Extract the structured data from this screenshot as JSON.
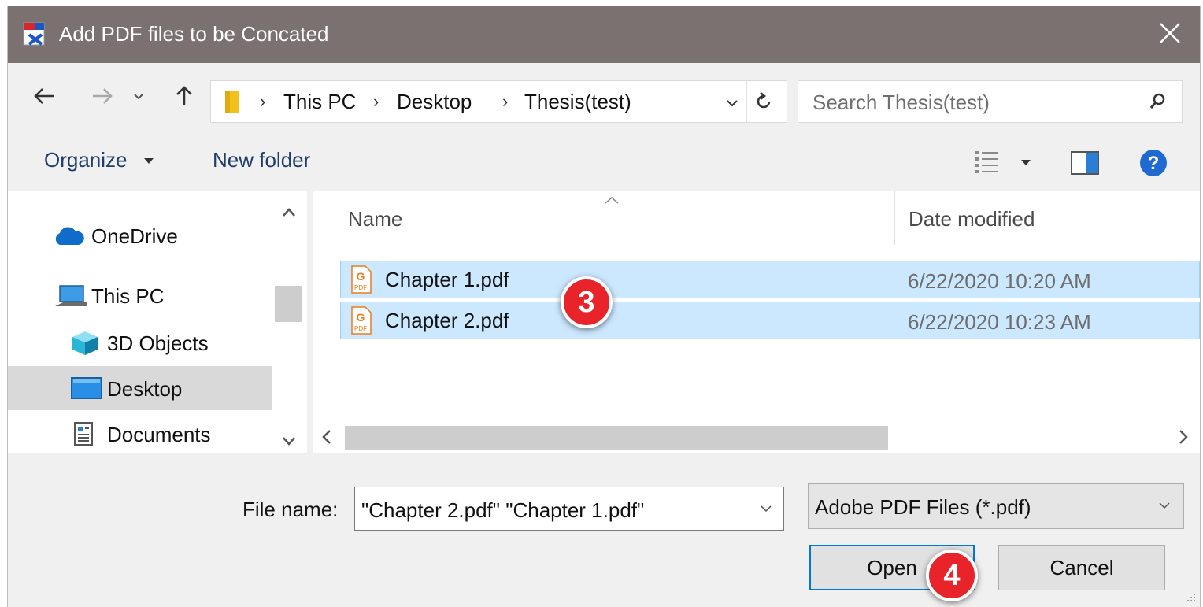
{
  "window": {
    "title": "Add PDF files to be Concated",
    "close_icon": "close-icon"
  },
  "nav": {
    "back_icon": "back-arrow-icon",
    "forward_icon": "forward-arrow-icon",
    "recent_icon": "chevron-down-icon",
    "up_icon": "up-arrow-icon",
    "breadcrumbs": [
      "This PC",
      "Desktop",
      "Thesis(test)"
    ],
    "refresh_icon": "refresh-icon",
    "search_placeholder": "Search Thesis(test)"
  },
  "toolbar": {
    "organize": "Organize",
    "new_folder": "New folder"
  },
  "sidebar": {
    "items": [
      {
        "label": "OneDrive",
        "icon": "cloud-icon"
      },
      {
        "label": "This PC",
        "icon": "computer-icon"
      },
      {
        "label": "3D Objects",
        "icon": "cube-icon"
      },
      {
        "label": "Desktop",
        "icon": "desktop-icon",
        "selected": true
      },
      {
        "label": "Documents",
        "icon": "document-icon"
      }
    ]
  },
  "files": {
    "columns": [
      "Name",
      "Date modified"
    ],
    "rows": [
      {
        "name": "Chapter 1.pdf",
        "date": "6/22/2020 10:20 AM",
        "selected": true
      },
      {
        "name": "Chapter 2.pdf",
        "date": "6/22/2020 10:23 AM",
        "selected": true
      }
    ]
  },
  "footer": {
    "file_name_label": "File name:",
    "file_name_value": "\"Chapter 2.pdf\" \"Chapter 1.pdf\"",
    "file_type": "Adobe PDF Files (*.pdf)",
    "open": "Open",
    "cancel": "Cancel"
  },
  "annotations": {
    "step3": "3",
    "step4": "4"
  },
  "colors": {
    "titlebar": "#7a7170",
    "selection": "#cce8ff",
    "marker": "#e8242a",
    "primary_border": "#0078d7"
  }
}
